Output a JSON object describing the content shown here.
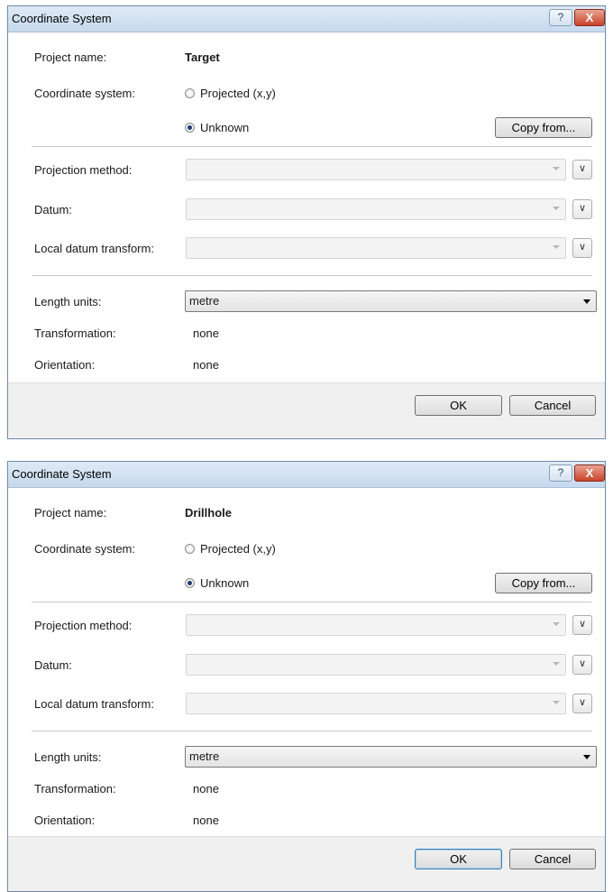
{
  "dialogs": [
    {
      "window_title": "Coordinate System",
      "help_button": "?",
      "close_button": "X",
      "project_name_label": "Project name:",
      "project_name_value": "Target",
      "coordinate_system_label": "Coordinate system:",
      "option_projected": "Projected (x,y)",
      "option_unknown": "Unknown",
      "selected_option": "Unknown",
      "copy_from_button": "Copy from...",
      "projection_method_label": "Projection method:",
      "projection_method_value": "",
      "datum_label": "Datum:",
      "datum_value": "",
      "local_datum_transform_label": "Local datum transform:",
      "local_datum_transform_value": "",
      "length_units_label": "Length units:",
      "length_units_value": "metre",
      "transformation_label": "Transformation:",
      "transformation_value": "none",
      "orientation_label": "Orientation:",
      "orientation_value": "none",
      "ok_button": "OK",
      "cancel_button": "Cancel"
    },
    {
      "window_title": "Coordinate System",
      "help_button": "?",
      "close_button": "X",
      "project_name_label": "Project name:",
      "project_name_value": "Drillhole",
      "coordinate_system_label": "Coordinate system:",
      "option_projected": "Projected (x,y)",
      "option_unknown": "Unknown",
      "selected_option": "Unknown",
      "copy_from_button": "Copy from...",
      "projection_method_label": "Projection method:",
      "projection_method_value": "",
      "datum_label": "Datum:",
      "datum_value": "",
      "local_datum_transform_label": "Local datum transform:",
      "local_datum_transform_value": "",
      "length_units_label": "Length units:",
      "length_units_value": "metre",
      "transformation_label": "Transformation:",
      "transformation_value": "none",
      "orientation_label": "Orientation:",
      "orientation_value": "none",
      "ok_button": "OK",
      "cancel_button": "Cancel"
    }
  ],
  "icons": {
    "expand": "double-chevron-down-icon",
    "dropdown": "chevron-down-icon",
    "help": "help-icon",
    "close": "close-icon"
  },
  "colors": {
    "titlebar": "#c6d9ee",
    "close_button": "#c9432a",
    "footer": "#f0f0f0",
    "primary_button_border": "#3c7fb1"
  }
}
